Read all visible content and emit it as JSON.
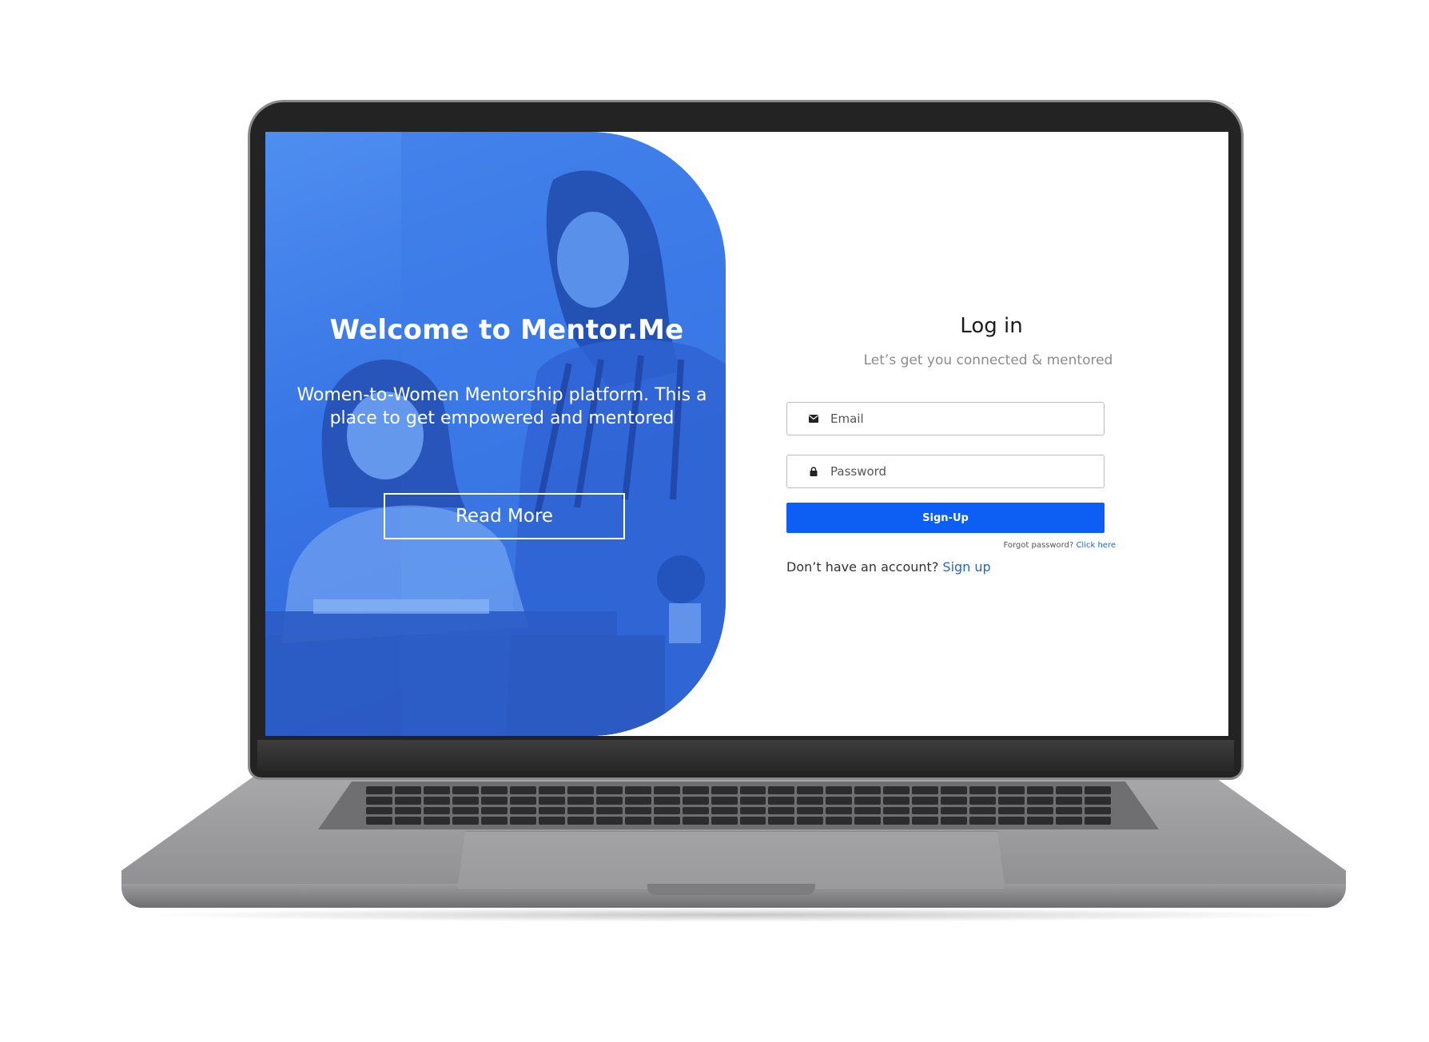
{
  "hero": {
    "title": "Welcome to Mentor.Me",
    "subtitle": "Women-to-Women Mentorship platform. This a place to get empowered and mentored",
    "read_more_label": "Read More",
    "color": "#3876e6"
  },
  "login": {
    "title": "Log in",
    "subtitle": "Let’s get you connected & mentored",
    "email": {
      "placeholder": "Email",
      "value": "",
      "icon": "envelope-icon"
    },
    "password": {
      "placeholder": "Password",
      "value": "",
      "icon": "lock-icon"
    },
    "submit_label": "Sign-Up",
    "submit_color": "#0d5ef5",
    "forgot_text": "Forgot password?",
    "forgot_link": "Click here",
    "account_text": "Don’t have an account?",
    "account_link": "Sign up"
  }
}
